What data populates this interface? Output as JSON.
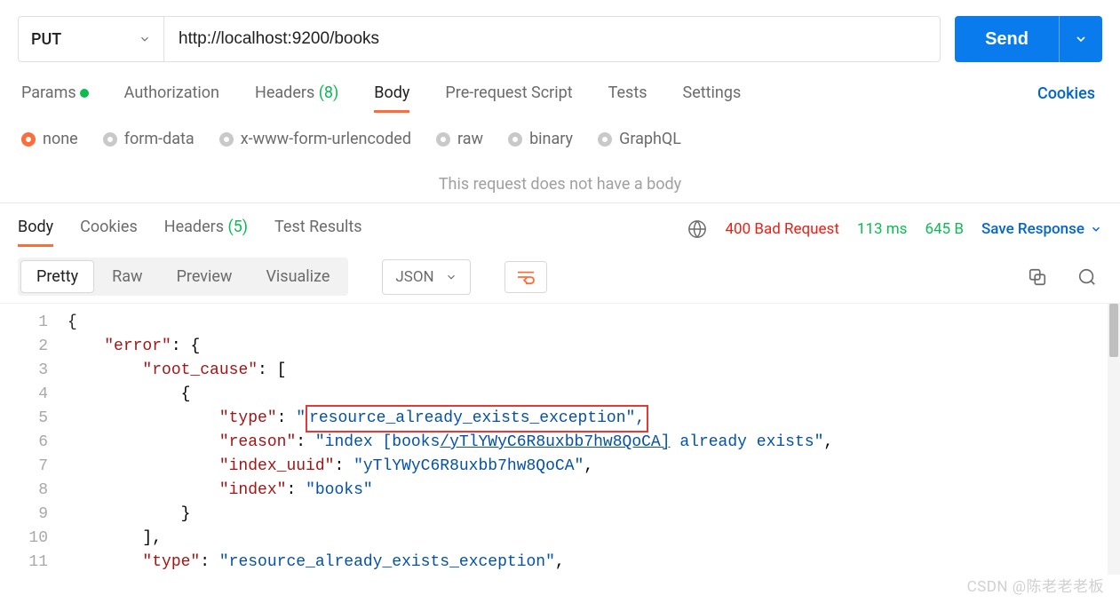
{
  "request": {
    "method": "PUT",
    "url": "http://localhost:9200/books",
    "sendLabel": "Send"
  },
  "reqTabs": {
    "params": "Params",
    "auth": "Authorization",
    "headers": "Headers",
    "headersCount": "(8)",
    "body": "Body",
    "preReq": "Pre-request Script",
    "tests": "Tests",
    "settings": "Settings",
    "cookies": "Cookies"
  },
  "bodyTypes": {
    "none": "none",
    "formData": "form-data",
    "xwww": "x-www-form-urlencoded",
    "raw": "raw",
    "binary": "binary",
    "graphql": "GraphQL"
  },
  "noBodyMsg": "This request does not have a body",
  "respTabs": {
    "body": "Body",
    "cookies": "Cookies",
    "headers": "Headers",
    "headersCount": "(5)",
    "testResults": "Test Results"
  },
  "respMeta": {
    "status": "400 Bad Request",
    "time": "113 ms",
    "size": "645 B",
    "save": "Save Response"
  },
  "viewModes": {
    "pretty": "Pretty",
    "raw": "Raw",
    "preview": "Preview",
    "visualize": "Visualize"
  },
  "langSelect": "JSON",
  "codeLines": {
    "l1": "{",
    "l2_key": "\"error\"",
    "l2_rest": ": {",
    "l3_key": "\"root_cause\"",
    "l3_rest": ": [",
    "l4": "{",
    "l5_key": "\"type\"",
    "l5_val": "resource_already_exists_exception",
    "l6_key": "\"reason\"",
    "l6_pre": "\"index [books",
    "l6_link": "/yTlYWyC6R8uxbb7hw8QoCA]",
    "l6_post": " already exists\"",
    "l7_key": "\"index_uuid\"",
    "l7_val": "\"yTlYWyC6R8uxbb7hw8QoCA\"",
    "l8_key": "\"index\"",
    "l8_val": "\"books\"",
    "l9": "}",
    "l10": "],",
    "l11_key": "\"type\"",
    "l11_val": "\"resource_already_exists_exception\""
  },
  "watermark": "CSDN @陈老老老板"
}
